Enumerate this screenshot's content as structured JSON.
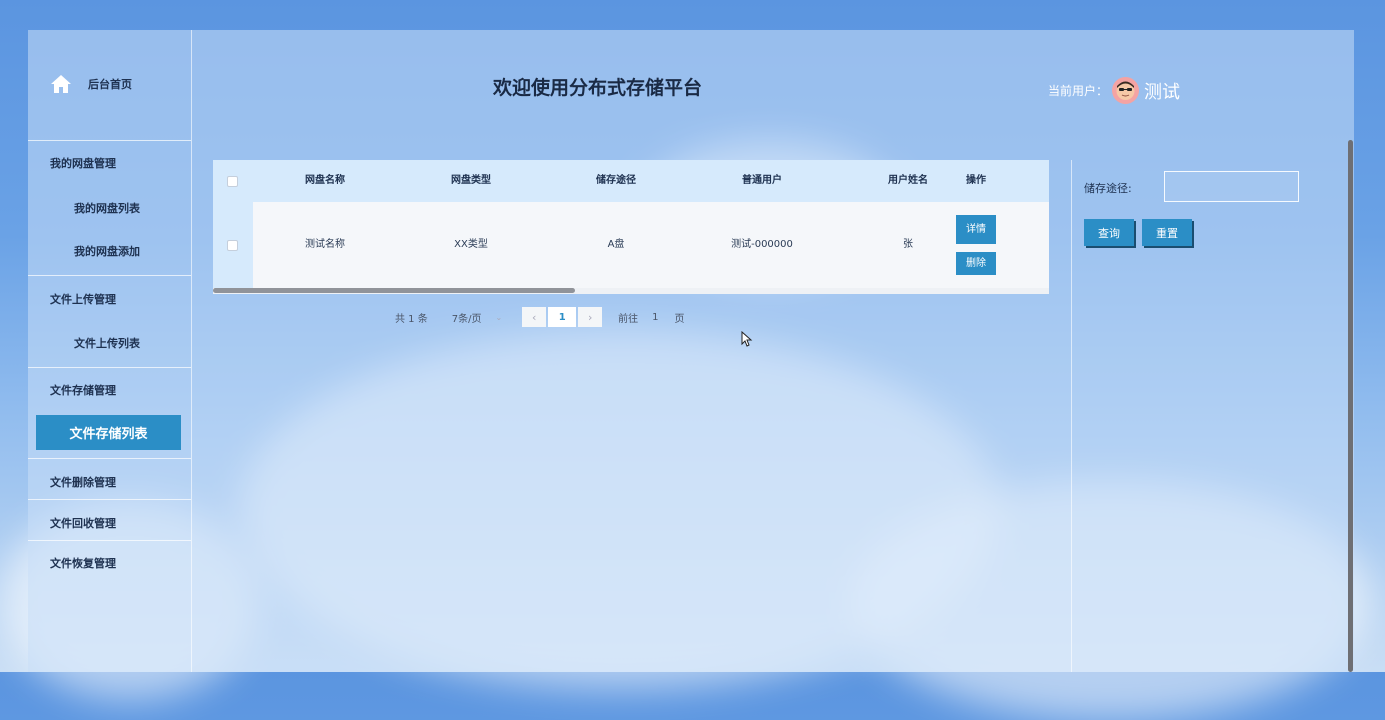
{
  "colors": {
    "accent": "#2b8ec6",
    "table_header": "#d6eafc",
    "text_dark": "#1e3150"
  },
  "sidebar": {
    "home_icon": "home-icon",
    "home_label": "后台首页",
    "groups": [
      {
        "title": "我的网盘管理",
        "items": [
          "我的网盘列表",
          "我的网盘添加"
        ]
      },
      {
        "title": "文件上传管理",
        "items": [
          "文件上传列表"
        ]
      },
      {
        "title": "文件存储管理",
        "items": [
          "文件存储列表"
        ]
      },
      {
        "title": "文件删除管理",
        "items": []
      },
      {
        "title": "文件回收管理",
        "items": []
      },
      {
        "title": "文件恢复管理",
        "items": []
      }
    ],
    "active_item": "文件存储列表"
  },
  "header": {
    "title": "欢迎使用分布式存储平台",
    "user_label": "当前用户：",
    "user_name": "测试"
  },
  "table": {
    "columns": [
      "网盘名称",
      "网盘类型",
      "储存途径",
      "普通用户",
      "用户姓名",
      "操作"
    ],
    "rows": [
      {
        "name": "测试名称",
        "type": "XX类型",
        "path": "A盘",
        "user": "测试-000000",
        "username": "张"
      }
    ],
    "actions": {
      "detail": "详情",
      "delete": "删除"
    }
  },
  "pagination": {
    "total": "共 1 条",
    "page_size": "7条/页",
    "current": "1",
    "goto_prefix": "前往",
    "goto_value": "1",
    "goto_suffix": "页"
  },
  "search": {
    "label": "储存途径:",
    "placeholder": "",
    "query_button": "查询",
    "reset_button": "重置"
  }
}
